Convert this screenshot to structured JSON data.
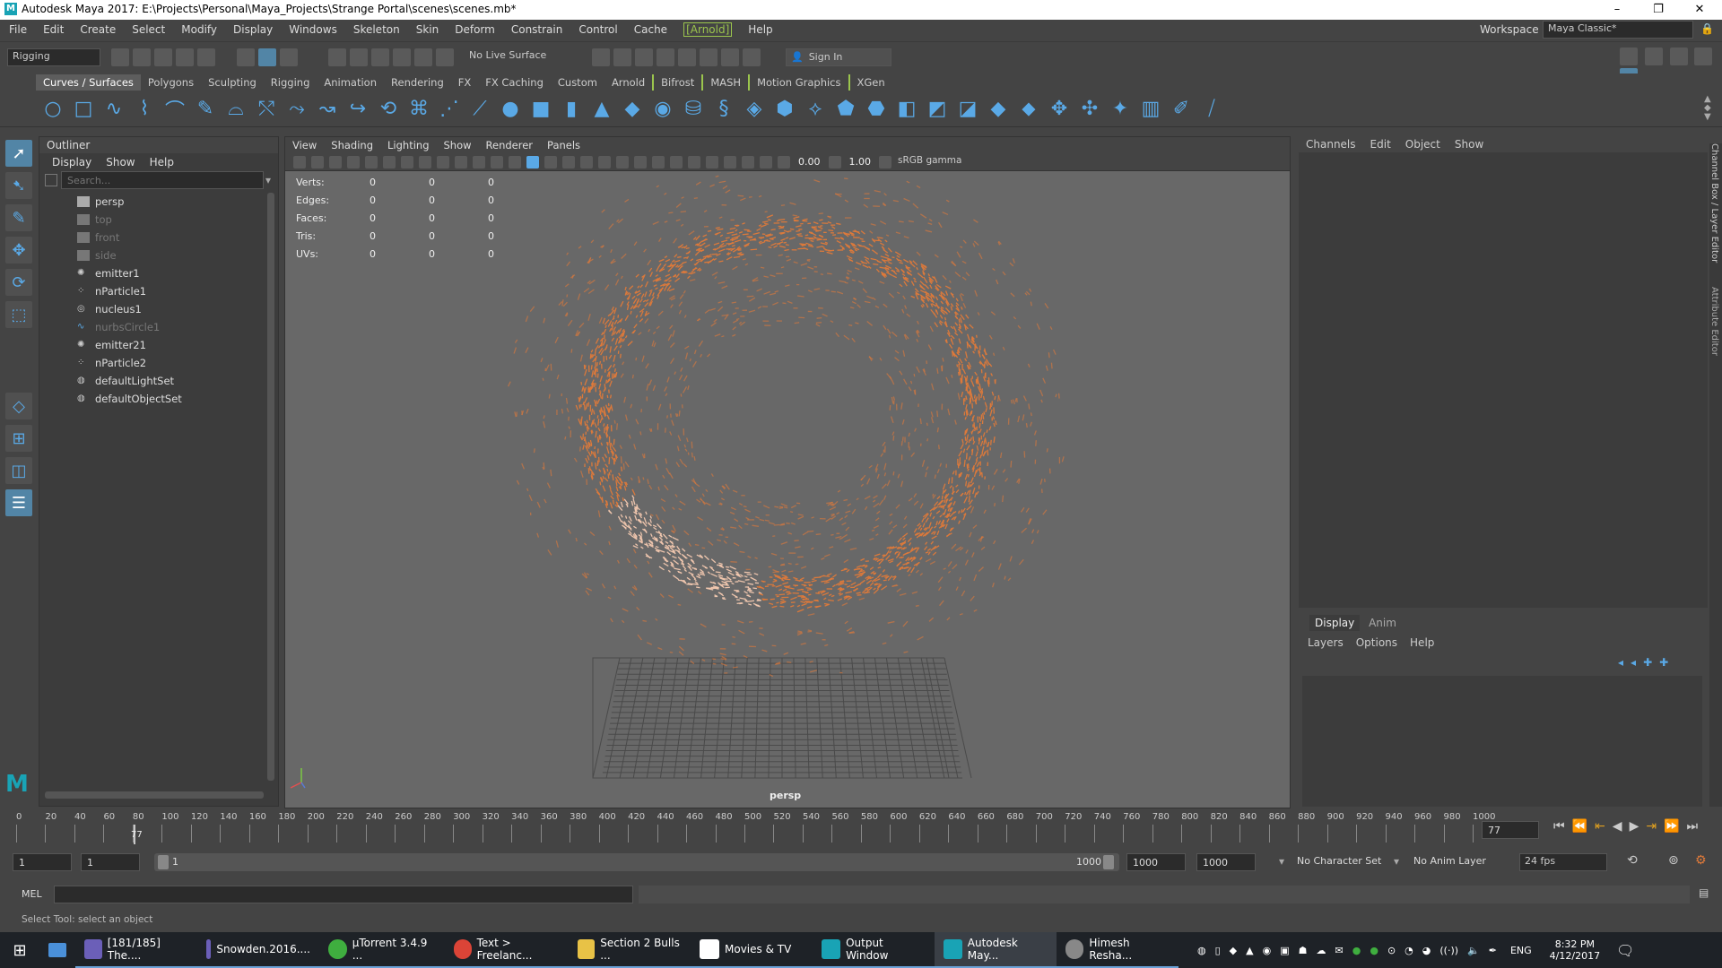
{
  "window": {
    "title": "Autodesk Maya 2017: E:\\Projects\\Personal\\Maya_Projects\\Strange Portal\\scenes\\scenes.mb*"
  },
  "menubar": {
    "items": [
      "File",
      "Edit",
      "Create",
      "Select",
      "Modify",
      "Display",
      "Windows",
      "Skeleton",
      "Skin",
      "Deform",
      "Constrain",
      "Control",
      "Cache",
      "[Arnold]",
      "Help"
    ],
    "workspace_label": "Workspace :",
    "workspace_value": "Maya Classic*"
  },
  "toolbar": {
    "menuset": "Rigging",
    "live_surface": "No Live Surface",
    "sign_in": "Sign In"
  },
  "shelf": {
    "tabs": [
      "Curves / Surfaces",
      "Polygons",
      "Sculpting",
      "Rigging",
      "Animation",
      "Rendering",
      "FX",
      "FX Caching",
      "Custom",
      "Arnold",
      "Bifrost",
      "MASH",
      "Motion Graphics",
      "XGen"
    ],
    "active": "Curves / Surfaces"
  },
  "outliner": {
    "title": "Outliner",
    "menu": [
      "Display",
      "Show",
      "Help"
    ],
    "search_placeholder": "Search...",
    "items": [
      {
        "label": "persp",
        "type": "camera",
        "dim": false
      },
      {
        "label": "top",
        "type": "camera",
        "dim": true
      },
      {
        "label": "front",
        "type": "camera",
        "dim": true
      },
      {
        "label": "side",
        "type": "camera",
        "dim": true
      },
      {
        "label": "emitter1",
        "type": "emitter",
        "dim": false
      },
      {
        "label": "nParticle1",
        "type": "particle",
        "dim": false
      },
      {
        "label": "nucleus1",
        "type": "nucleus",
        "dim": false
      },
      {
        "label": "nurbsCircle1",
        "type": "curve",
        "dim": true
      },
      {
        "label": "emitter21",
        "type": "emitter",
        "dim": false
      },
      {
        "label": "nParticle2",
        "type": "particle",
        "dim": false
      },
      {
        "label": "defaultLightSet",
        "type": "set",
        "dim": false
      },
      {
        "label": "defaultObjectSet",
        "type": "set",
        "dim": false
      }
    ]
  },
  "viewport": {
    "menu": [
      "View",
      "Shading",
      "Lighting",
      "Show",
      "Renderer",
      "Panels"
    ],
    "exposure": "0.00",
    "gamma": "1.00",
    "color_space": "sRGB gamma",
    "hud": [
      {
        "label": "Verts:",
        "v1": "0",
        "v2": "0",
        "v3": "0"
      },
      {
        "label": "Edges:",
        "v1": "0",
        "v2": "0",
        "v3": "0"
      },
      {
        "label": "Faces:",
        "v1": "0",
        "v2": "0",
        "v3": "0"
      },
      {
        "label": "Tris:",
        "v1": "0",
        "v2": "0",
        "v3": "0"
      },
      {
        "label": "UVs:",
        "v1": "0",
        "v2": "0",
        "v3": "0"
      }
    ],
    "camera_label": "persp",
    "particle_color": "#e07a3a"
  },
  "channelbox": {
    "menu": [
      "Channels",
      "Edit",
      "Object",
      "Show"
    ],
    "side_tabs": [
      "Channel Box / Layer Editor",
      "Attribute Editor"
    ]
  },
  "layers": {
    "tabs": [
      "Display",
      "Anim"
    ],
    "menu": [
      "Layers",
      "Options",
      "Help"
    ]
  },
  "timeline": {
    "ticks": [
      "0",
      "20",
      "40",
      "60",
      "80",
      "100",
      "120",
      "140",
      "160",
      "180",
      "200",
      "220",
      "240",
      "260",
      "280",
      "300",
      "320",
      "340",
      "360",
      "380",
      "400",
      "420",
      "440",
      "460",
      "480",
      "500",
      "520",
      "540",
      "560",
      "580",
      "600",
      "620",
      "640",
      "660",
      "680",
      "700",
      "720",
      "740",
      "760",
      "780",
      "800",
      "820",
      "840",
      "860",
      "880",
      "900",
      "920",
      "940",
      "960",
      "980",
      "1000"
    ],
    "current_frame": "77",
    "current_marker": "77"
  },
  "range": {
    "start": "1",
    "start2": "1",
    "slider_start": "1",
    "slider_end": "1000",
    "end": "1000",
    "end2": "1000",
    "character_set": "No Character Set",
    "anim_layer": "No Anim Layer",
    "fps": "24 fps"
  },
  "mel": {
    "label": "MEL"
  },
  "helpline": {
    "text": "Select Tool: select an object"
  },
  "taskbar": {
    "items": [
      {
        "label": "[181/185] The....",
        "color": "#6b5fb8",
        "open": true
      },
      {
        "label": "Snowden.2016....",
        "color": "#6b5fb8",
        "open": true
      },
      {
        "label": "µTorrent 3.4.9 ...",
        "color": "#3fae3f",
        "open": true
      },
      {
        "label": "Text > Freelanc...",
        "color": "#db4437",
        "open": true
      },
      {
        "label": "Section 2 Bulls ...",
        "color": "#e8c246",
        "open": true
      },
      {
        "label": "Movies & TV",
        "color": "#ffffff",
        "open": true
      },
      {
        "label": "Output Window",
        "color": "#19a3b5",
        "open": true
      },
      {
        "label": "Autodesk May...",
        "color": "#19a3b5",
        "open": true
      },
      {
        "label": "Himesh Resha...",
        "color": "#888888",
        "open": true
      }
    ],
    "language": "ENG",
    "time": "8:32 PM",
    "date": "4/12/2017"
  }
}
